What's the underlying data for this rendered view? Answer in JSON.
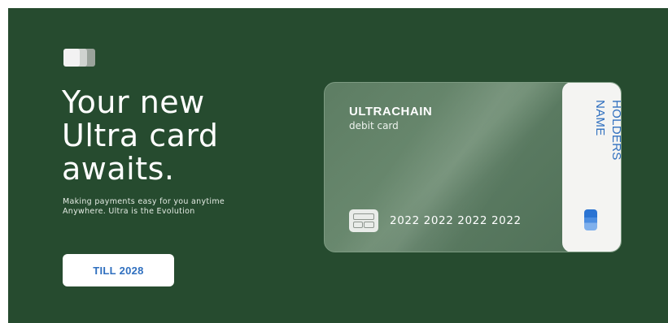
{
  "hero": {
    "background_color": "#264b2f",
    "logo_icon": "card-stack-icon",
    "headline": [
      "Your new",
      "Ultra card",
      "awaits."
    ],
    "subtext": [
      "Making payments easy for you anytime",
      "Anywhere. Ultra is the Evolution"
    ],
    "cta_label": "TILL 2028"
  },
  "card": {
    "brand": "ULTRACHAIN",
    "type": "debit card",
    "number": "2022 2022 2022 2022",
    "holder_name": [
      "HOLDERS",
      "NAME"
    ],
    "chip_icon": "chip-icon",
    "contactless_icon": "contactless-icon",
    "accent_color": "#2f6fbf"
  }
}
